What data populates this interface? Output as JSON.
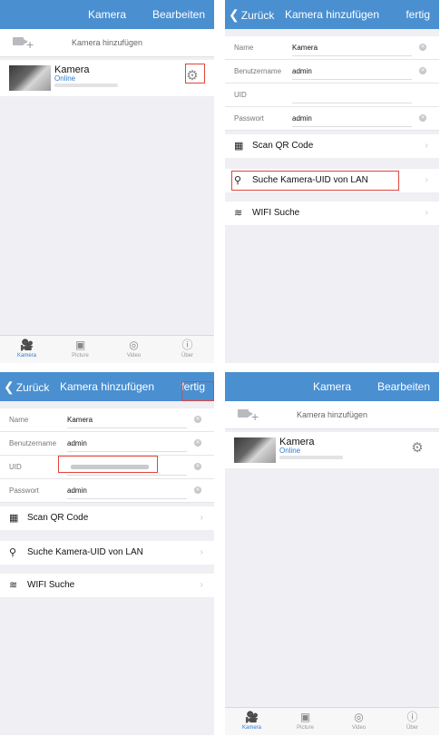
{
  "home": {
    "title": "Kamera",
    "edit": "Bearbeiten",
    "add_camera": "Kamera hinzufügen",
    "camera_name": "Kamera",
    "camera_status": "Online",
    "tabs": [
      {
        "label": "Kamera",
        "icon": "camera-tab-icon"
      },
      {
        "label": "Picture",
        "icon": "picture-tab-icon"
      },
      {
        "label": "Video",
        "icon": "video-tab-icon"
      },
      {
        "label": "Über",
        "icon": "info-tab-icon"
      }
    ]
  },
  "add": {
    "back": "Zurück",
    "title": "Kamera hinzufügen",
    "done": "fertig",
    "fields": {
      "name_label": "Name",
      "name_value": "Kamera",
      "user_label": "Benutzername",
      "user_value": "admin",
      "uid_label": "UID",
      "password_label": "Passwort",
      "password_value": "admin"
    },
    "actions": {
      "qr": "Scan QR Code",
      "lan": "Suche Kamera-UID von LAN",
      "wifi": "WIFI Suche"
    }
  },
  "colors": {
    "accent": "#4a8fd0",
    "highlight": "#e4443a",
    "status": "#2f7bd0"
  }
}
